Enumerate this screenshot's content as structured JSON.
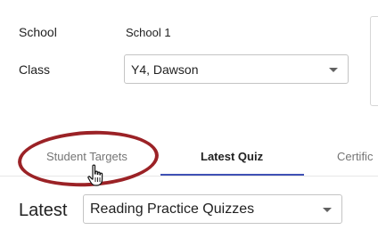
{
  "form": {
    "school_label": "School",
    "school_value": "School 1",
    "class_label": "Class",
    "class_value": "Y4, Dawson"
  },
  "tabs": [
    {
      "label": "Student Targets",
      "active": false
    },
    {
      "label": "Latest Quiz",
      "active": true
    },
    {
      "label": "Certific",
      "active": false
    }
  ],
  "latest": {
    "label": "Latest",
    "select_value": "Reading Practice Quizzes"
  },
  "colors": {
    "accent": "#3f51b5",
    "highlight_ring": "#9b2226"
  },
  "icons": {
    "dropdown": "chevron-down-icon",
    "cursor": "hand-pointer-icon"
  }
}
